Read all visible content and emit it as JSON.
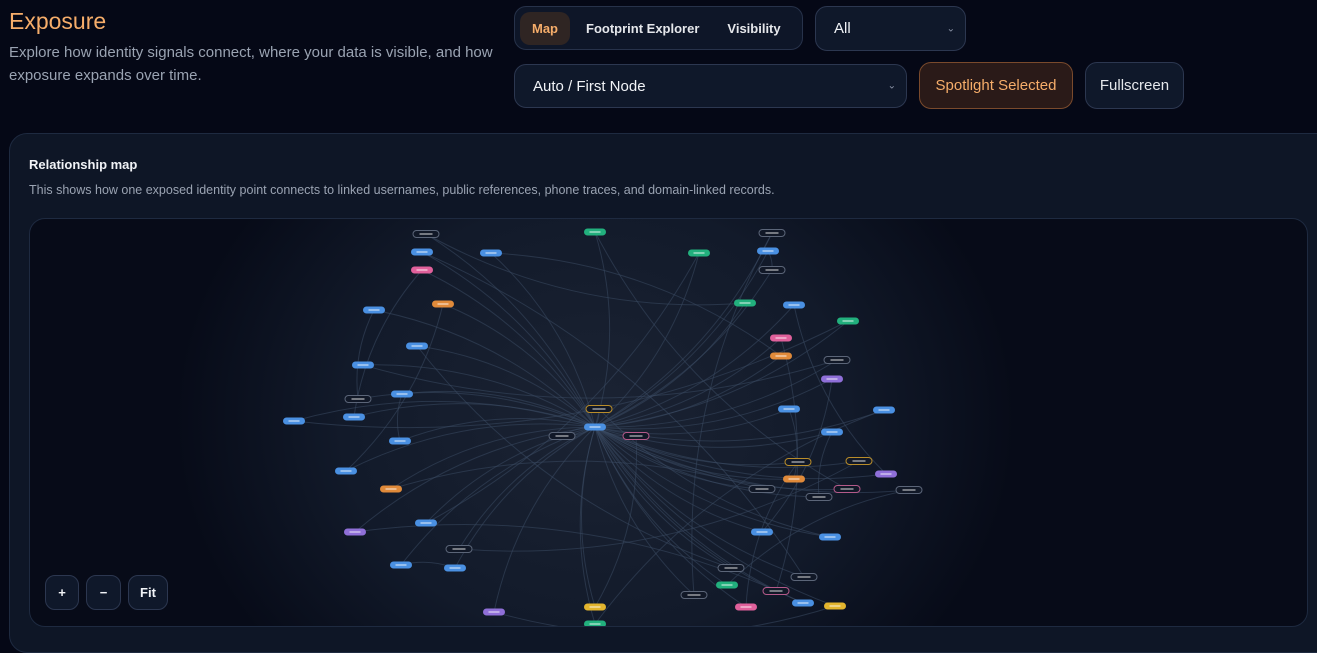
{
  "header": {
    "title": "Exposure",
    "subtitle": "Explore how identity signals connect, where your data is visible, and how exposure expands over time."
  },
  "tabs": [
    {
      "label": "Map",
      "active": true
    },
    {
      "label": "Footprint Explorer"
    },
    {
      "label": "Visibility"
    }
  ],
  "filter_select": {
    "value": "All"
  },
  "focus_select": {
    "value": "Auto / First Node"
  },
  "buttons": {
    "spotlight": "Spotlight Selected",
    "fullscreen": "Fullscreen"
  },
  "card": {
    "title": "Relationship map",
    "description": "This shows how one exposed identity point connects to linked usernames, public references, phone traces, and domain-linked records."
  },
  "zoom_controls": {
    "zoom_in": "+",
    "zoom_out": "−",
    "fit": "Fit"
  },
  "node_colors": {
    "blue": "#4a90e2",
    "green": "#22b07d",
    "pink": "#e0609b",
    "orange": "#e08a3a",
    "purple": "#8f6fd8",
    "yellow": "#e3b52e",
    "outline": "#5b6578",
    "outlineY": "#b98d2a",
    "outlineP": "#b45a8a"
  }
}
